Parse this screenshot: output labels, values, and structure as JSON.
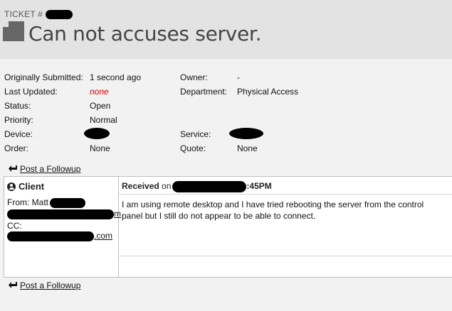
{
  "header": {
    "ticket_prefix": "TICKET #",
    "title": "Can not accuses server."
  },
  "details": {
    "originally_submitted_label": "Originally Submitted:",
    "originally_submitted_value": "1 second ago",
    "last_updated_label": "Last Updated:",
    "last_updated_value": "none",
    "status_label": "Status:",
    "status_value": "Open",
    "priority_label": "Priority:",
    "priority_value": "Normal",
    "device_label": "Device:",
    "order_label": "Order:",
    "order_value": "None",
    "owner_label": "Owner:",
    "owner_value": "-",
    "department_label": "Department:",
    "department_value": "Physical Access",
    "service_label": "Service:",
    "quote_label": "Quote:",
    "quote_value": "None"
  },
  "actions": {
    "post_followup": "Post a Followup"
  },
  "post": {
    "client_heading": "Client",
    "from_label": "From: Matt",
    "email_tail": "m",
    "cc_label": "CC:",
    "cc_tail": ".com",
    "received_label": "Received",
    "received_on": "on",
    "received_time": ":45PM",
    "message": "I am using remote desktop and I have tried rebooting the server from the control panel but I still do not appear to be able to connect."
  },
  "colors": {
    "header_bg": "#e3e3e3",
    "page_bg": "#f2f2f2",
    "none_red": "#cc0000"
  }
}
